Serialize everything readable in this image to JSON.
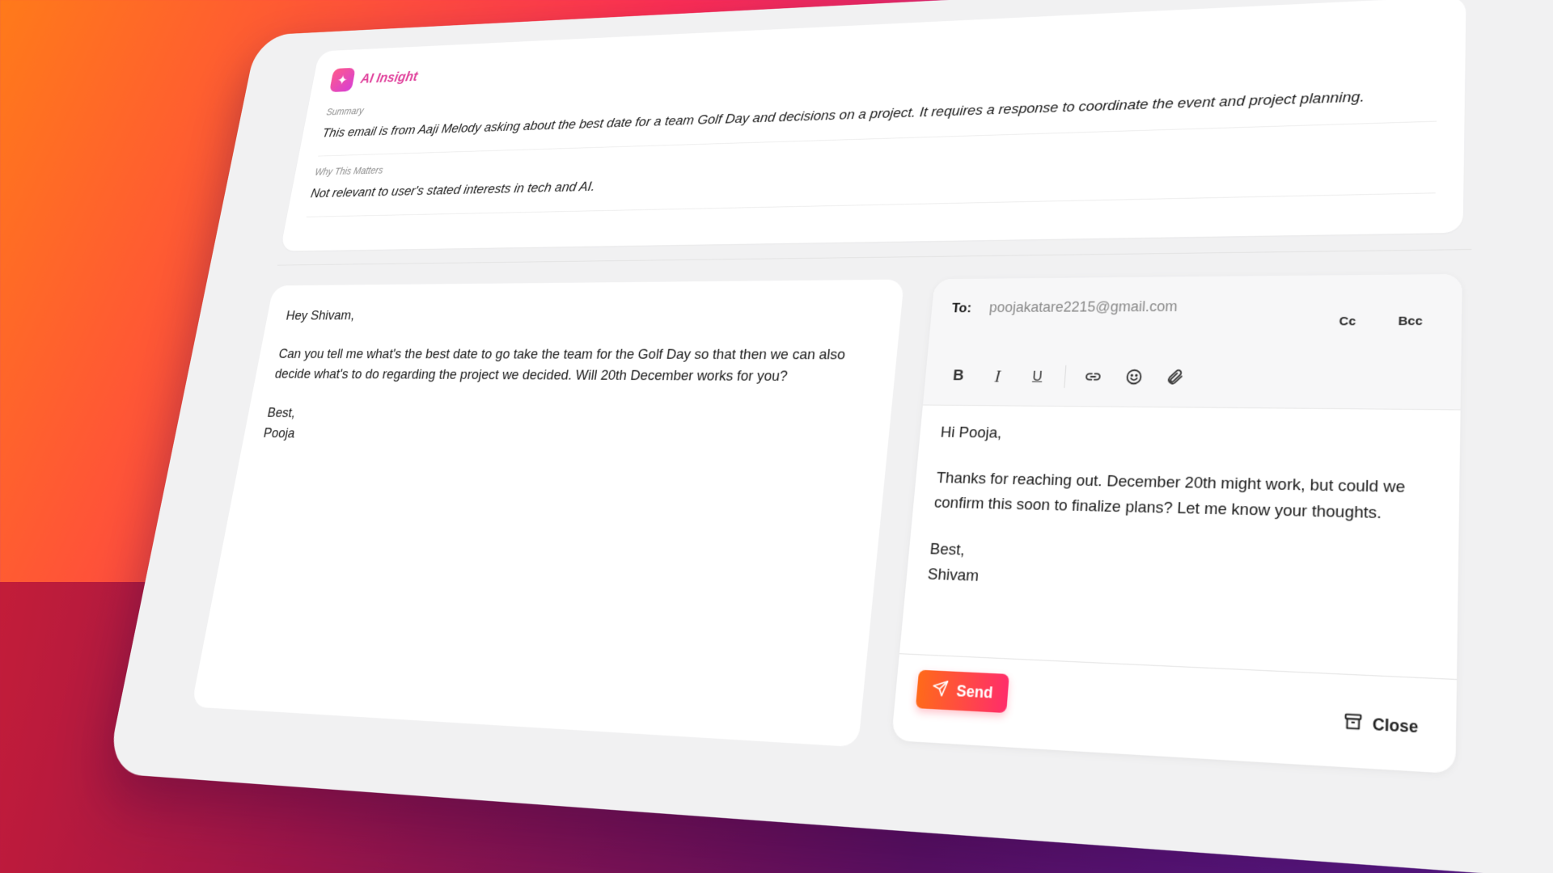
{
  "insight": {
    "title": "AI Insight",
    "summary_label": "Summary",
    "summary_text": "This email is from Aaji Melody asking about the best date for a team Golf Day and decisions on a project. It requires a response to coordinate the event and project planning.",
    "why_label": "Why This Matters",
    "why_text": "Not relevant to user's stated interests in tech and AI."
  },
  "email": {
    "greeting": "Hey Shivam,",
    "body": "Can you tell me what's the best date to go take the team for the Golf Day so that then we can also decide what's to do regarding the project we decided. Will 20th December works for you?",
    "closing": "Best,",
    "sender": "Pooja"
  },
  "reply": {
    "to_label": "To:",
    "to_value": "poojakatare2215@gmail.com",
    "cc_label": "Cc",
    "bcc_label": "Bcc",
    "greeting": "Hi Pooja,",
    "body": "Thanks for reaching out. December 20th might work, but could we confirm this soon to finalize plans? Let me know your thoughts.",
    "closing": "Best,",
    "signature": "Shivam",
    "send_label": "Send",
    "close_label": "Close"
  },
  "toolbar": {
    "bold": "B",
    "italic": "I",
    "underline": "U",
    "icons": [
      "link-icon",
      "emoji-icon",
      "attachment-icon"
    ]
  },
  "colors": {
    "accent_start": "#ff6a1a",
    "accent_end": "#ff2d6a",
    "ai_title": "#e0429c"
  }
}
